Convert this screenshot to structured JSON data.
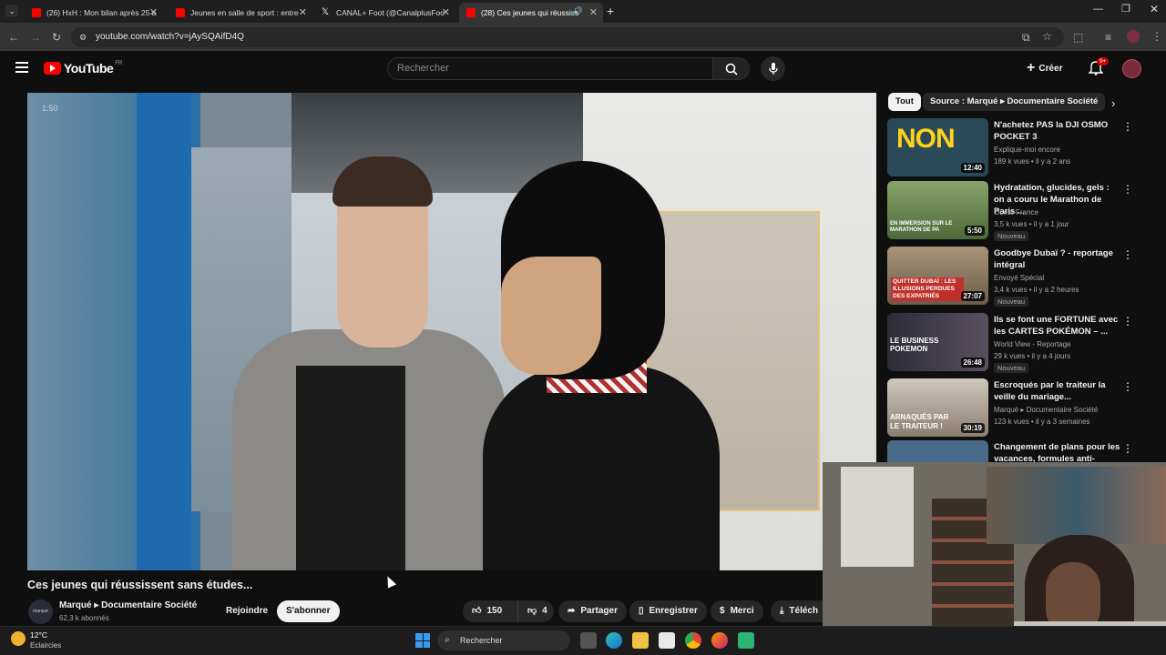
{
  "tabs": [
    {
      "label": "(26) HxH : Mon bilan après 25 a",
      "color": "#ff0000",
      "active": false
    },
    {
      "label": "Jeunes en salle de sport : entre",
      "color": "#ff0000",
      "active": false
    },
    {
      "label": "CANAL+ Foot (@CanalplusFoo",
      "color": "#ffffff",
      "active": false
    },
    {
      "label": "(28) Ces jeunes qui réussiss",
      "color": "#ff0000",
      "active": true
    }
  ],
  "address": "youtube.com/watch?v=jAySQAifD4Q",
  "youtube": {
    "logo_text": "YouTube",
    "region": "FR",
    "search_placeholder": "Rechercher",
    "create_label": "Créer",
    "notif_badge": "9+"
  },
  "player": {
    "time_hint": "1:50"
  },
  "video": {
    "title": "Ces jeunes qui réussissent sans études...",
    "channel": "Marqué ▸ Documentaire Société",
    "subscribers": "62,3 k abonnés",
    "join_label": "Rejoindre",
    "subscribe_label": "S'abonner",
    "likes": "150",
    "dislikes": "4",
    "share_label": "Partager",
    "save_label": "Enregistrer",
    "thanks_label": "Merci",
    "download_label": "Téléch"
  },
  "filters": {
    "all": "Tout",
    "source": "Source : Marqué ▸ Documentaire Société"
  },
  "recommendations": [
    {
      "title": "N'achetez PAS la DJI OSMO POCKET 3",
      "channel": "Explique-moi encore",
      "meta": "189 k vues • il y a 2 ans",
      "duration": "12:40",
      "thumb_text": "NON",
      "badge": "",
      "thumb_color": "#2a4a5a"
    },
    {
      "title": "Hydratation, glucides, gels : on a couru le Marathon de Paris ...",
      "channel": "Ouest-France",
      "meta": "3,5 k vues • il y a 1 jour",
      "duration": "5:50",
      "thumb_text": "EN IMMERSION SUR LE MARATHON DE PA",
      "badge": "Nouveau",
      "thumb_color": "#5d7a4a"
    },
    {
      "title": "Goodbye Dubaï ? - reportage intégral",
      "channel": "Envoyé Spécial",
      "meta": "3,4 k vues • il y a 2 heures",
      "duration": "27:07",
      "thumb_text": "QUITTER DUBAÏ : LES ILLUSIONS PERDUES DES EXPATRIÉS",
      "badge": "Nouveau",
      "thumb_color": "#8a7860"
    },
    {
      "title": "Ils se font une FORTUNE avec les CARTES POKÉMON – ...",
      "channel": "World View - Reportage",
      "meta": "29 k vues • il y a 4 jours",
      "duration": "26:48",
      "thumb_text": "LE BUSINESS POKEMON",
      "badge": "Nouveau",
      "thumb_color": "#3c3c48"
    },
    {
      "title": "Escroqués par le traiteur la veille du mariage...",
      "channel": "Marqué ▸ Documentaire Société",
      "meta": "123 k vues • il y a 3 semaines",
      "duration": "30:19",
      "thumb_text": "ARNAQUÉS PAR LE TRAITEUR !",
      "badge": "",
      "thumb_color": "#a09080"
    },
    {
      "title": "Changement de plans pour les vacances, formules anti-crise...",
      "channel": "",
      "meta": "",
      "duration": "",
      "thumb_text": "",
      "badge": "",
      "thumb_color": "#4a6a8a"
    }
  ],
  "taskbar": {
    "weather_temp": "12°C",
    "weather_desc": "Eclaircies",
    "search_label": "Rechercher"
  }
}
